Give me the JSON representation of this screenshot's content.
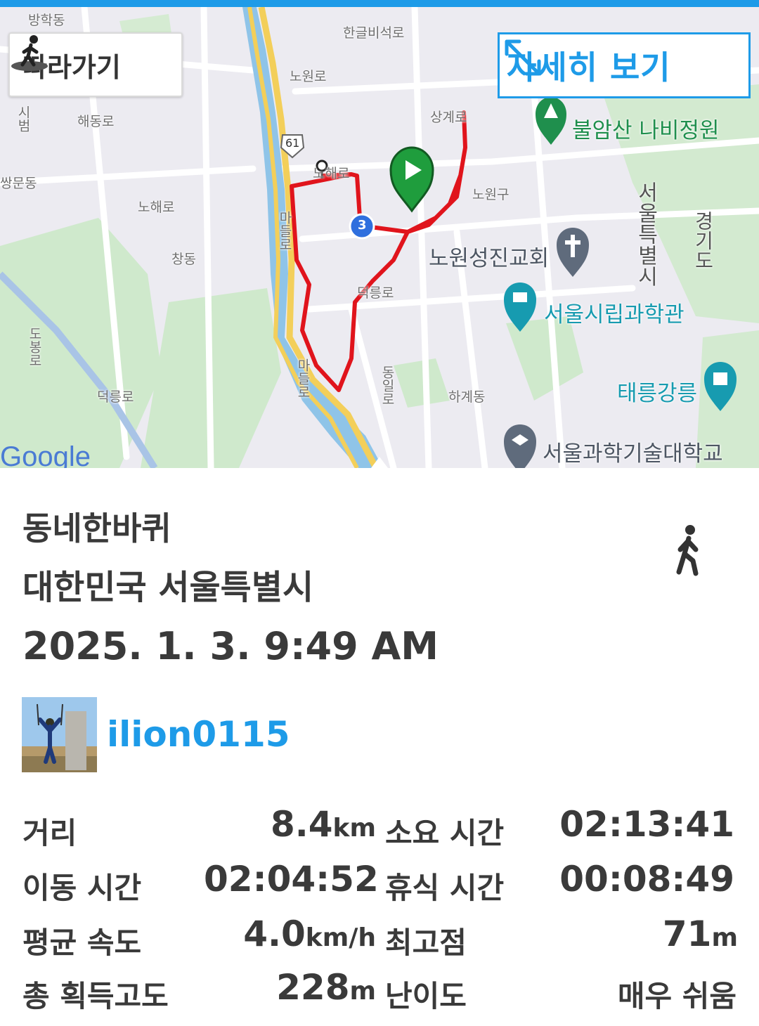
{
  "map": {
    "follow_label": "따라가기",
    "detail_label": "자세히 보기",
    "google_label": "Google",
    "route_color": "#e0141c",
    "poi_labels": {
      "butterfly_garden": "불암산 나비정원",
      "church": "노원성진교회",
      "science_museum": "서울시립과학관",
      "taereung": "태릉강릉",
      "seoultech": "서울과학기술대학교"
    },
    "road_labels": {
      "hangeulbiseok_ro": "한글비석로",
      "nowon_ro": "노원로",
      "haedeung_ro": "해동로",
      "nohae_ro_a": "노해로",
      "nohae_ro_b": "노해로",
      "deokneung_ro_a": "덕릉로",
      "deokneung_ro_b": "덕릉로",
      "madeul_ro_a": "마들로",
      "madeul_ro_b": "마들로",
      "sanggye_ro": "상계로",
      "nowon_gu": "노원구",
      "chang_dong": "창동",
      "hagye_dong": "하계동",
      "seoul_city_vertical": "서울특별시",
      "gyeonggi_vertical": "경기도",
      "dobong_ro": "도봉로",
      "ssangmun_dong": "쌍문동",
      "banghak_dong": "방학동",
      "sibeom": "시범",
      "dongil_ro": "동일로",
      "route_61": "61",
      "waypoint_3": "3"
    }
  },
  "track": {
    "title": "동네한바퀴",
    "region": "대한민국 서울특별시",
    "date": "2025. 1. 3. 9:49 AM",
    "activity_icon": "walking-person-icon"
  },
  "user": {
    "name": "ilion0115",
    "avatar_icon": "hiker-photo-avatar"
  },
  "stats": {
    "distance_label": "거리",
    "distance_value": "8.4",
    "distance_unit": "km",
    "total_time_label": "소요 시간",
    "total_time_value": "02:13:41",
    "moving_time_label": "이동 시간",
    "moving_time_value": "02:04:52",
    "rest_time_label": "휴식 시간",
    "rest_time_value": "00:08:49",
    "avg_speed_label": "평균 속도",
    "avg_speed_value": "4.0",
    "avg_speed_unit": "km/h",
    "max_alt_label": "최고점",
    "max_alt_value": "71",
    "max_alt_unit": "m",
    "elev_gain_label": "총 획득고도",
    "elev_gain_value": "228",
    "elev_gain_unit": "m",
    "difficulty_label": "난이도",
    "difficulty_value": "매우 쉬움"
  }
}
